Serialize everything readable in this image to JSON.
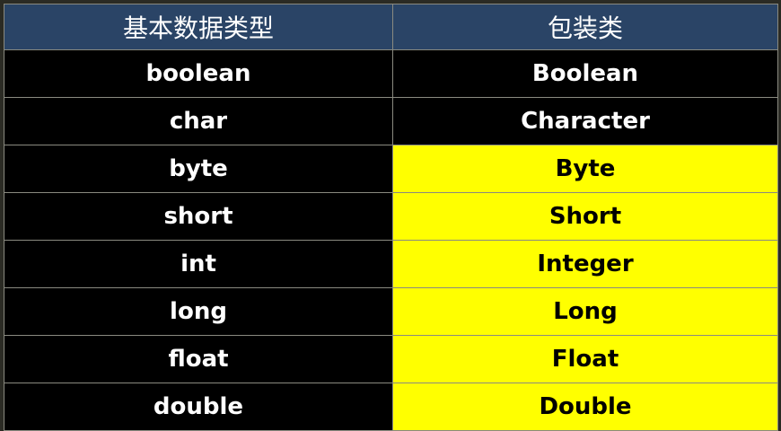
{
  "table": {
    "headers": {
      "primitive": "基本数据类型",
      "wrapper": "包装类"
    },
    "rows": [
      {
        "primitive": "boolean",
        "wrapper": "Boolean",
        "highlighted": false
      },
      {
        "primitive": "char",
        "wrapper": "Character",
        "highlighted": false
      },
      {
        "primitive": "byte",
        "wrapper": "Byte",
        "highlighted": true
      },
      {
        "primitive": "short",
        "wrapper": "Short",
        "highlighted": true
      },
      {
        "primitive": "int",
        "wrapper": "Integer",
        "highlighted": true
      },
      {
        "primitive": "long",
        "wrapper": "Long",
        "highlighted": true
      },
      {
        "primitive": "float",
        "wrapper": "Float",
        "highlighted": true
      },
      {
        "primitive": "double",
        "wrapper": "Double",
        "highlighted": true
      }
    ]
  },
  "colors": {
    "header_bg": "#2a4466",
    "header_text": "#ffffff",
    "cell_bg": "#000000",
    "cell_text": "#ffffff",
    "highlight_bg": "#ffff00",
    "highlight_text": "#000000",
    "border": "#8a8a80"
  }
}
